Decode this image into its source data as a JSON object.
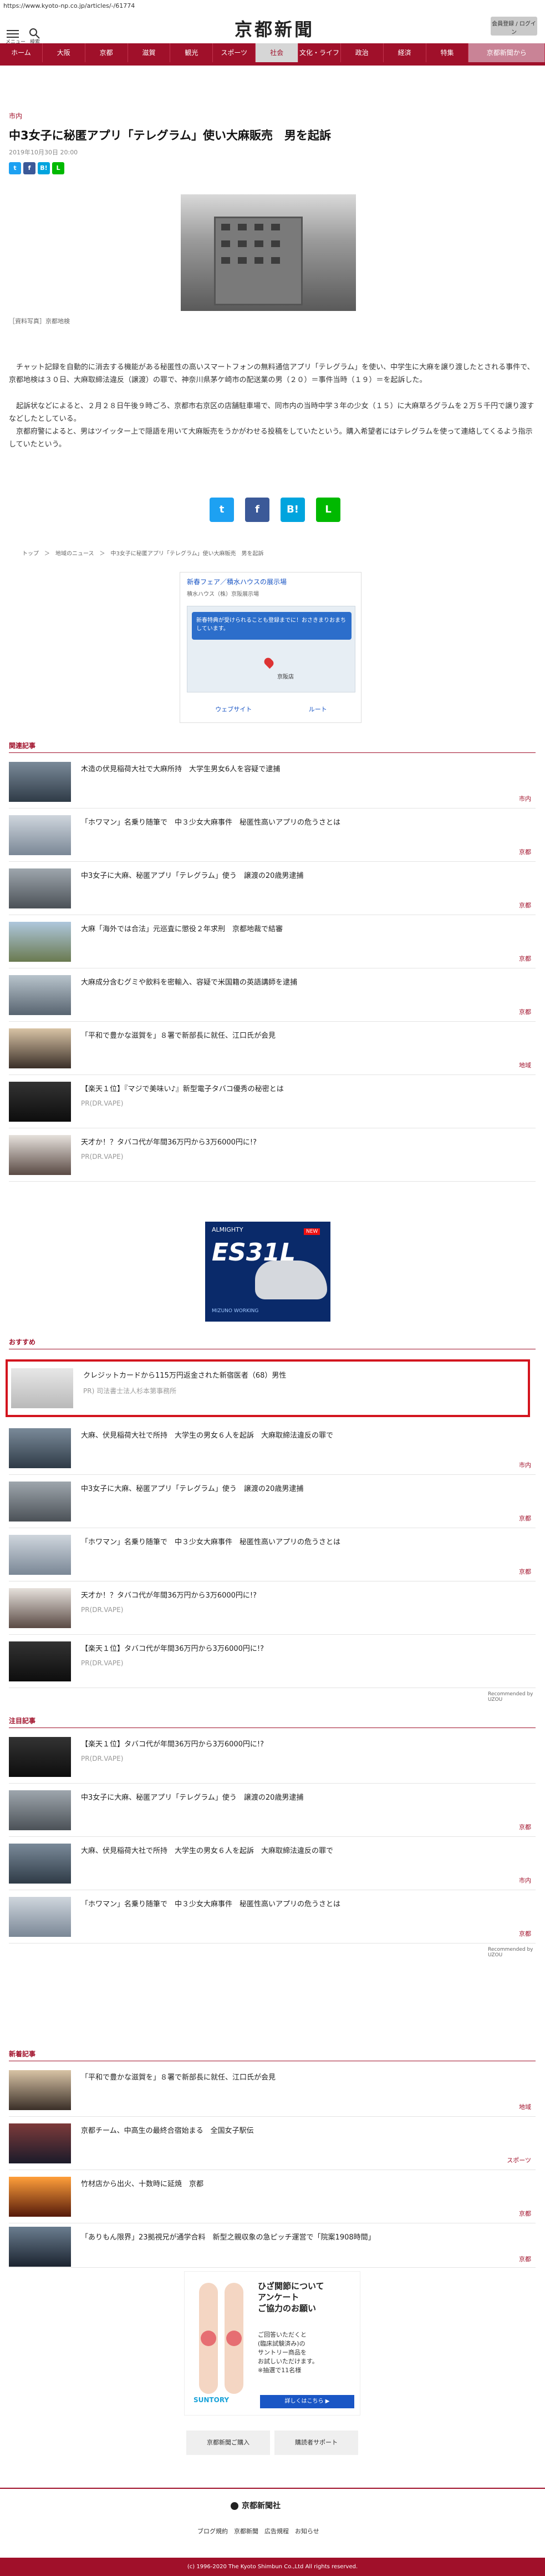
{
  "url": "https://www.kyoto-np.co.jp/articles/-/61774",
  "header": {
    "menu_label": "メニュー",
    "search_label": "検索",
    "logo": "京都新聞",
    "login_label": "会員登録 / ログイン"
  },
  "nav": [
    "ホーム",
    "大阪",
    "京都",
    "滋賀",
    "観光",
    "スポーツ",
    "社会",
    "文化・ライフ",
    "政治",
    "経済",
    "特集",
    "京都新聞から"
  ],
  "article": {
    "category": "市内",
    "title": "中3女子に秘匿アプリ「テレグラム」使い大麻販売　男を起訴",
    "date": "2019年10月30日 20:00",
    "caption": "［資料写真］京都地検",
    "paragraphs": [
      "チャット記録を自動的に消去する機能がある秘匿性の高いスマートフォンの無料通信アプリ「テレグラム」を使い、中学生に大麻を譲り渡したとされる事件で、京都地検は３０日、大麻取締法違反（譲渡）の罪で、神奈川県茅ケ崎市の配送業の男（２０）＝事件当時（１９）＝を起訴した。",
      "起訴状などによると、２月２８日午後９時ごろ、京都市右京区の店舗駐車場で、同市内の当時中学３年の少女（１５）に大麻草ろグラムを２万５千円で譲り渡すなどしたとしている。",
      "京都府警によると、男はツイッター上で隠語を用いて大麻販売をうかがわせる投稿をしていたという。購入希望者にはテレグラムを使って連絡してくるよう指示していたという。"
    ]
  },
  "share": [
    "t",
    "f",
    "B!",
    "L"
  ],
  "breadcrumb": "トップ　＞　地域のニュース　＞　中3女子に秘匿アプリ「テレグラム」使い大麻販売　男を起訴",
  "top_ad": {
    "title": "新春フェア／積水ハウスの展示場",
    "sub": "積水ハウス（株）京阪展示場",
    "map_msg": "新春特典が受けられることも登録までに！おさきまりおまちしています。",
    "store": "京阪店",
    "actions": [
      "ウェブサイト",
      "ルート"
    ]
  },
  "related": {
    "heading": "関連記事",
    "items": [
      {
        "title": "木造の伏見稲荷大社で大麻所持　大学生男女6人を容疑で逮捕",
        "tag": "市内"
      },
      {
        "title": "「ホワマン」名乗り随筆で　中３少女大麻事件　秘匿性高いアプリの危うさとは",
        "tag": "京都"
      },
      {
        "title": "中3女子に大麻、秘匿アプリ「テレグラム」使う　譲渡の20歳男逮捕",
        "tag": "京都"
      },
      {
        "title": "大麻「海外では合法」元巡査に懲役２年求刑　京都地裁で結審",
        "tag": "京都"
      },
      {
        "title": "大麻成分含むグミや飲料を密輸入、容疑で米国籍の英語講師を逮捕",
        "tag": "京都"
      },
      {
        "title": "「平和で豊かな滋賀を」８署で新部長に就任、江口氏が会見",
        "tag": "地域"
      },
      {
        "title": "【楽天１位】『マジで美味い♪』新型電子タバコ優秀の秘密とは",
        "sub": "PR(DR.VAPE)"
      },
      {
        "title": "天才か！？タバコ代が年間36万円から3万6000円に!?",
        "sub": "PR(DR.VAPE)"
      }
    ]
  },
  "shoe_ad": {
    "brand": "ALMIGHTY",
    "name": "ES31L",
    "badge": "NEW",
    "footer": "MIZUNO WORKING"
  },
  "recommend": {
    "heading": "おすすめ",
    "items": [
      {
        "title": "クレジットカードから115万円返金された新宿医者（68）男性",
        "sub": "PR) 司法書士法人杉本第事務所"
      },
      {
        "title": "大麻、伏見稲荷大社で所持　大学生の男女６人を起訴　大麻取締法違反の罪で",
        "tag": "市内"
      },
      {
        "title": "中3女子に大麻、秘匿アプリ「テレグラム」使う　譲渡の20歳男逮捕",
        "tag": "京都"
      },
      {
        "title": "「ホワマン」名乗り随筆で　中３少女大麻事件　秘匿性高いアプリの危うさとは",
        "tag": "京都"
      },
      {
        "title": "天才か！？タバコ代が年間36万円から3万6000円に!?",
        "sub": "PR(DR.VAPE)"
      },
      {
        "title": "【楽天１位】タバコ代が年間36万円から3万6000円に!?",
        "sub": "PR(DR.VAPE)"
      }
    ],
    "credit": "Recommended by UZOU"
  },
  "notable": {
    "heading": "注目記事",
    "items": [
      {
        "title": "【楽天１位】タバコ代が年間36万円から3万6000円に!?",
        "sub": "PR(DR.VAPE)"
      },
      {
        "title": "中3女子に大麻、秘匿アプリ「テレグラム」使う　譲渡の20歳男逮捕",
        "tag": "京都"
      },
      {
        "title": "大麻、伏見稲荷大社で所持　大学生の男女６人を起訴　大麻取締法違反の罪で",
        "tag": "市内"
      },
      {
        "title": "「ホワマン」名乗り随筆で　中３少女大麻事件　秘匿性高いアプリの危うさとは",
        "tag": "京都"
      }
    ],
    "credit": "Recommended by UZOU"
  },
  "latest": {
    "heading": "新着記事",
    "items": [
      {
        "title": "「平和で豊かな滋賀を」８署で新部長に就任、江口氏が会見",
        "tag": "地域"
      },
      {
        "title": "京都チーム、中高生の最終合宿始まる　全国女子駅伝",
        "tag": "スポーツ"
      },
      {
        "title": "竹材店から出火、十数時に延焼　京都",
        "tag": "京都"
      },
      {
        "title": "「ありもん限界」23拠視兄が通学合料　新型之親収象の急ピッチ運営で「院案1908時間」",
        "tag": "京都"
      }
    ]
  },
  "legs_ad": {
    "title": "ひざ関節について\nアンケート\nご協力のお願い",
    "body": "ご回答いただくと\n(臨床試験済み)の\nサントリー商品を\nお試しいただけます。\n※抽選で11名様",
    "brand": "SUNTORY",
    "button": "詳しくはこちら ▶"
  },
  "footer": {
    "buttons": [
      "京都新聞ご購入",
      "購読者サポート"
    ],
    "logo": "京都新聞社",
    "links": "ブログ規約　京都新聞　広告規程　お知らせ",
    "copyright": "(c) 1996-2020 The Kyoto Shimbun Co.,Ltd All rights reserved."
  },
  "colors": {
    "brand": "#a0102a",
    "highlight": "#d3141e",
    "link": "#1a56c5"
  }
}
